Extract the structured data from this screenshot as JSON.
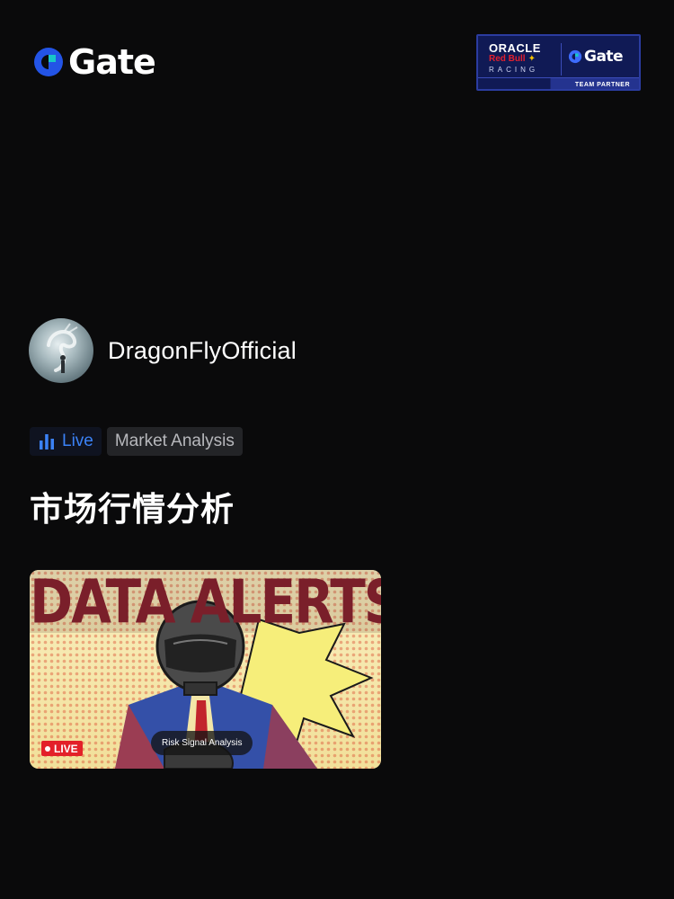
{
  "brand": {
    "logo_text": "Gate",
    "accent": "#2354e6",
    "accent_light": "#17c7c7"
  },
  "partner_badge": {
    "oracle": "ORACLE",
    "redbull": "Red Bull",
    "racing": "RACING",
    "gate": "Gate",
    "team_partner": "TEAM PARTNER"
  },
  "author": {
    "name": "DragonFlyOfficial",
    "avatar_icon": "dragon-avatar"
  },
  "tags": {
    "live_label": "Live",
    "category_label": "Market Analysis",
    "live_color": "#3b82f6"
  },
  "post": {
    "title": "市场行情分析"
  },
  "stream_card": {
    "banner_text": "DATA ALERTSK",
    "live_badge": "LIVE",
    "caption": "Risk Signal Analysis"
  }
}
